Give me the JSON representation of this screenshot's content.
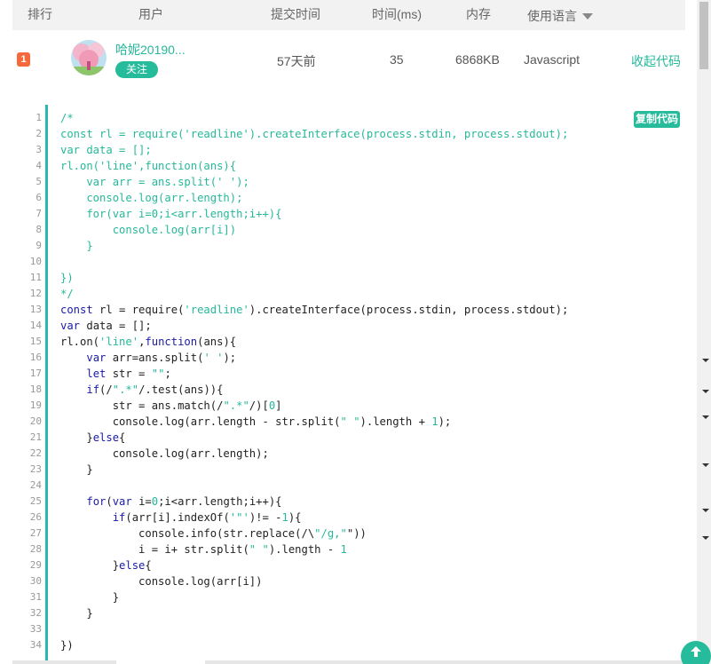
{
  "table_header": {
    "rank": "排行",
    "user": "用户",
    "submit_time": "提交时间",
    "time_ms": "时间(ms)",
    "memory": "内存",
    "language": "使用语言"
  },
  "row": {
    "rank": "1",
    "username": "哈妮20190...",
    "follow": "关注",
    "submit_time": "57天前",
    "time_ms": "35",
    "memory": "6868KB",
    "language": "Javascript",
    "collapse": "收起代码"
  },
  "code": {
    "copy_label": "复制代码",
    "lines": [
      "/*",
      "const rl = require('readline').createInterface(process.stdin, process.stdout);",
      "var data = [];",
      "rl.on('line',function(ans){",
      "    var arr = ans.split(' ');",
      "    console.log(arr.length);",
      "    for(var i=0;i<arr.length;i++){",
      "        console.log(arr[i])",
      "    }",
      "",
      "})",
      "*/",
      "const rl = require('readline').createInterface(process.stdin, process.stdout);",
      "var data = [];",
      "rl.on('line',function(ans){",
      "    var arr=ans.split(' ');",
      "    let str = \"\";",
      "    if(/\".*\"/.test(ans)){",
      "        str = ans.match(/\".*\"/)[0]",
      "        console.log(arr.length - str.split(\" \").length + 1);",
      "    }else{",
      "        console.log(arr.length);",
      "    }",
      "",
      "    for(var i=0;i<arr.length;i++){",
      "        if(arr[i].indexOf('\"')!= -1){",
      "            console.info(str.replace(/\\\"/g,\"\"))",
      "            i = i+ str.split(\" \").length - 1",
      "        }else{",
      "            console.log(arr[i])",
      "        }",
      "    }",
      "",
      "})"
    ]
  },
  "colors": {
    "accent": "#25bb9b",
    "rank_badge": "#f4683b",
    "gutter_border": "#2ab8b0",
    "keyword": "#1a1aa6"
  },
  "icons": {
    "sort": "caret-down-icon",
    "back_to_top": "arrow-up-icon"
  }
}
